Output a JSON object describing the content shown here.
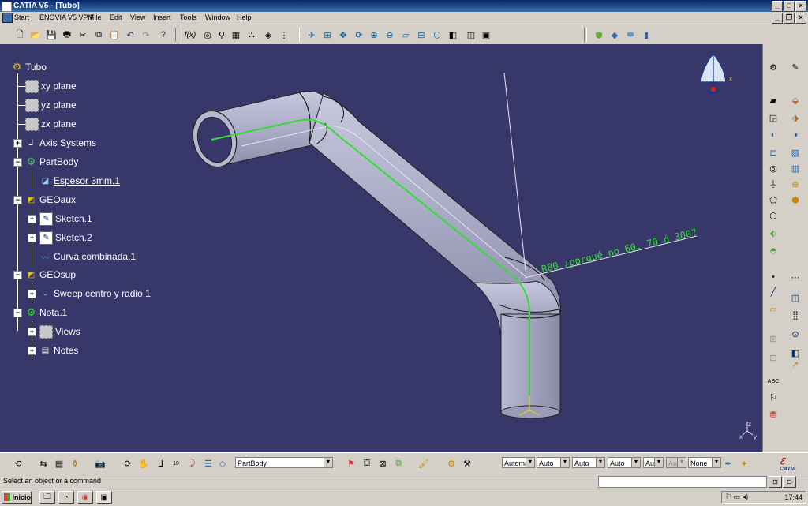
{
  "window": {
    "title": "CATIA V5 - [Tubo]"
  },
  "menu": {
    "items": [
      "Start",
      "ENOVIA V5 VPM",
      "File",
      "Edit",
      "View",
      "Insert",
      "Tools",
      "Window",
      "Help"
    ]
  },
  "tree": {
    "root": "Tubo",
    "xy": "xy plane",
    "yz": "yz plane",
    "zx": "zx plane",
    "axis": "Axis Systems",
    "partbody": "PartBody",
    "espesor": "Espesor 3mm.1",
    "geoaux": "GEOaux",
    "sketch1": "Sketch.1",
    "sketch2": "Sketch.2",
    "curva": "Curva combinada.1",
    "geosup": "GEOsup",
    "sweep": "Sweep centro y radio.1",
    "nota": "Nota.1",
    "views": "Views",
    "notes": "Notes"
  },
  "annotation": {
    "text": "R80 ¿porqué no 60, 70 ó 300?"
  },
  "compass": {
    "label": "x"
  },
  "axis_label": {
    "x": "x",
    "y": "y",
    "z": "z"
  },
  "bottom": {
    "current_body": "PartBody",
    "combos": [
      "Automa",
      "Auto",
      "Auto",
      "Auto",
      "Aut",
      "Aut",
      "None"
    ],
    "catia_logo": "CATIA"
  },
  "status": {
    "message": "Select an object or a command"
  },
  "taskbar": {
    "start": "Inicio",
    "clock": "17:44"
  },
  "colors": {
    "background": "#38376a",
    "tube": "#a8a9c8",
    "spine": "#33dd33",
    "annotation": "#33dd33"
  }
}
